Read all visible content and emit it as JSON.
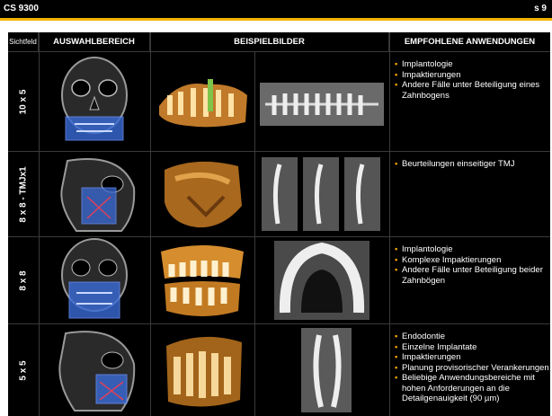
{
  "header": {
    "product": "CS 9300",
    "page": "s 9"
  },
  "columns": {
    "fov": "Sichtfeld",
    "selection": "AUSWAHLBEREICH",
    "examples": "BEISPIELBILDER",
    "applications": "EMPFOHLENE ANWENDUNGEN"
  },
  "rows": [
    {
      "fov": "10 x 5",
      "apps": [
        "Implantologie",
        "Impaktierungen",
        "Andere Fälle unter Beteiligung eines Zahnbogens"
      ]
    },
    {
      "fov": "8 x 8 - TMJx1",
      "apps": [
        "Beurteilungen einseitiger TMJ"
      ]
    },
    {
      "fov": "8 x 8",
      "apps": [
        "Implantologie",
        "Komplexe Impaktierungen",
        "Andere Fälle unter Beteiligung beider Zahnbögen"
      ]
    },
    {
      "fov": "5 x 5",
      "apps": [
        "Endodontie",
        "Einzelne Implantate",
        "Impaktierungen",
        "Planung provisorischer Verankerungen",
        "Beliebige Anwendungsbereiche mit hohen Anforderungen an die Detailgenauigkeit (90 µm)"
      ]
    }
  ],
  "colors": {
    "accent": "#f2b300",
    "bullet": "#f2a200",
    "fov_box": "#3a6bd8"
  }
}
